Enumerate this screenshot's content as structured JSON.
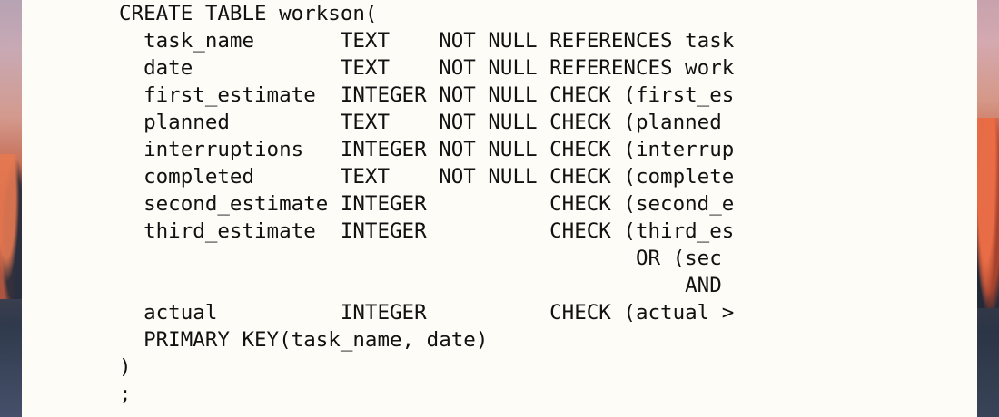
{
  "document": {
    "code_lines": [
      "CREATE TABLE workson(",
      "  task_name       TEXT    NOT NULL REFERENCES task",
      "  date            TEXT    NOT NULL REFERENCES work",
      "  first_estimate  INTEGER NOT NULL CHECK (first_es",
      "  planned         TEXT    NOT NULL CHECK (planned ",
      "  interruptions   INTEGER NOT NULL CHECK (interrup",
      "  completed       TEXT    NOT NULL CHECK (complete",
      "  second_estimate INTEGER          CHECK (second_e",
      "  third_estimate  INTEGER          CHECK (third_es",
      "                                          OR (sec",
      "                                              AND",
      "  actual          INTEGER          CHECK (actual >",
      "  PRIMARY KEY(task_name, date)",
      ")",
      ";"
    ]
  }
}
